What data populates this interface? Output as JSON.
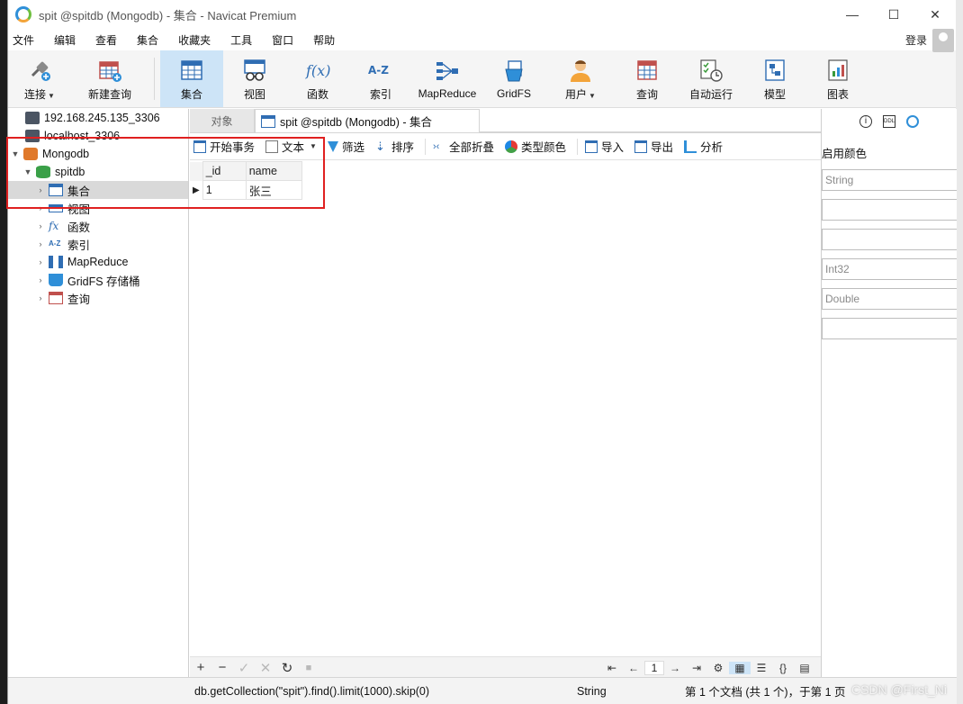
{
  "window": {
    "title": "spit @spitdb (Mongodb) - 集合 - Navicat Premium",
    "minimize": "—",
    "maximize": "☐",
    "close": "✕"
  },
  "menu": {
    "items": [
      "文件",
      "编辑",
      "查看",
      "集合",
      "收藏夹",
      "工具",
      "窗口",
      "帮助"
    ],
    "login": "登录"
  },
  "toolbar": {
    "connect": "连接",
    "new_query": "新建查询",
    "collection": "集合",
    "view": "视图",
    "function": "函数",
    "index": "索引",
    "mapreduce": "MapReduce",
    "gridfs": "GridFS",
    "user": "用户",
    "query": "查询",
    "autorun": "自动运行",
    "model": "模型",
    "chart": "图表",
    "index_glyph": "A-Z",
    "function_glyph": "f(x)"
  },
  "sidebar": {
    "conn1": "192.168.245.135_3306",
    "conn2": "localhost_3306",
    "conn3": "Mongodb",
    "db": "spitdb",
    "nodes": {
      "collection": "集合",
      "view": "视图",
      "function": "函数",
      "index": "索引",
      "mapreduce": "MapReduce",
      "gridfs": "GridFS 存储桶",
      "query": "查询"
    }
  },
  "tabs": {
    "objects": "对象",
    "doc": "spit @spitdb (Mongodb) - 集合"
  },
  "subtoolbar": {
    "begin_tx": "开始事务",
    "text": "文本",
    "filter": "筛选",
    "sort": "排序",
    "collapse_all": "全部折叠",
    "type_color": "类型颜色",
    "import": "导入",
    "export": "导出",
    "analyze": "分析"
  },
  "grid": {
    "columns": [
      "_id",
      "name"
    ],
    "rows": [
      [
        "1",
        "张三"
      ]
    ]
  },
  "footer": {
    "add": "+",
    "delete": "−",
    "apply": "✓",
    "discard": "✕",
    "refresh": "↻",
    "stop": "■",
    "page": "1"
  },
  "status": {
    "query": "db.getCollection(\"spit\").find().limit(1000).skip(0)",
    "type": "String",
    "records": "第 1 个文档 (共 1 个)，于第 1 页"
  },
  "rightpanel": {
    "label": "启用颜色",
    "fields": [
      "String",
      "",
      "",
      "Int32",
      "Double",
      ""
    ]
  },
  "watermark": "CSDN @First_Ni"
}
